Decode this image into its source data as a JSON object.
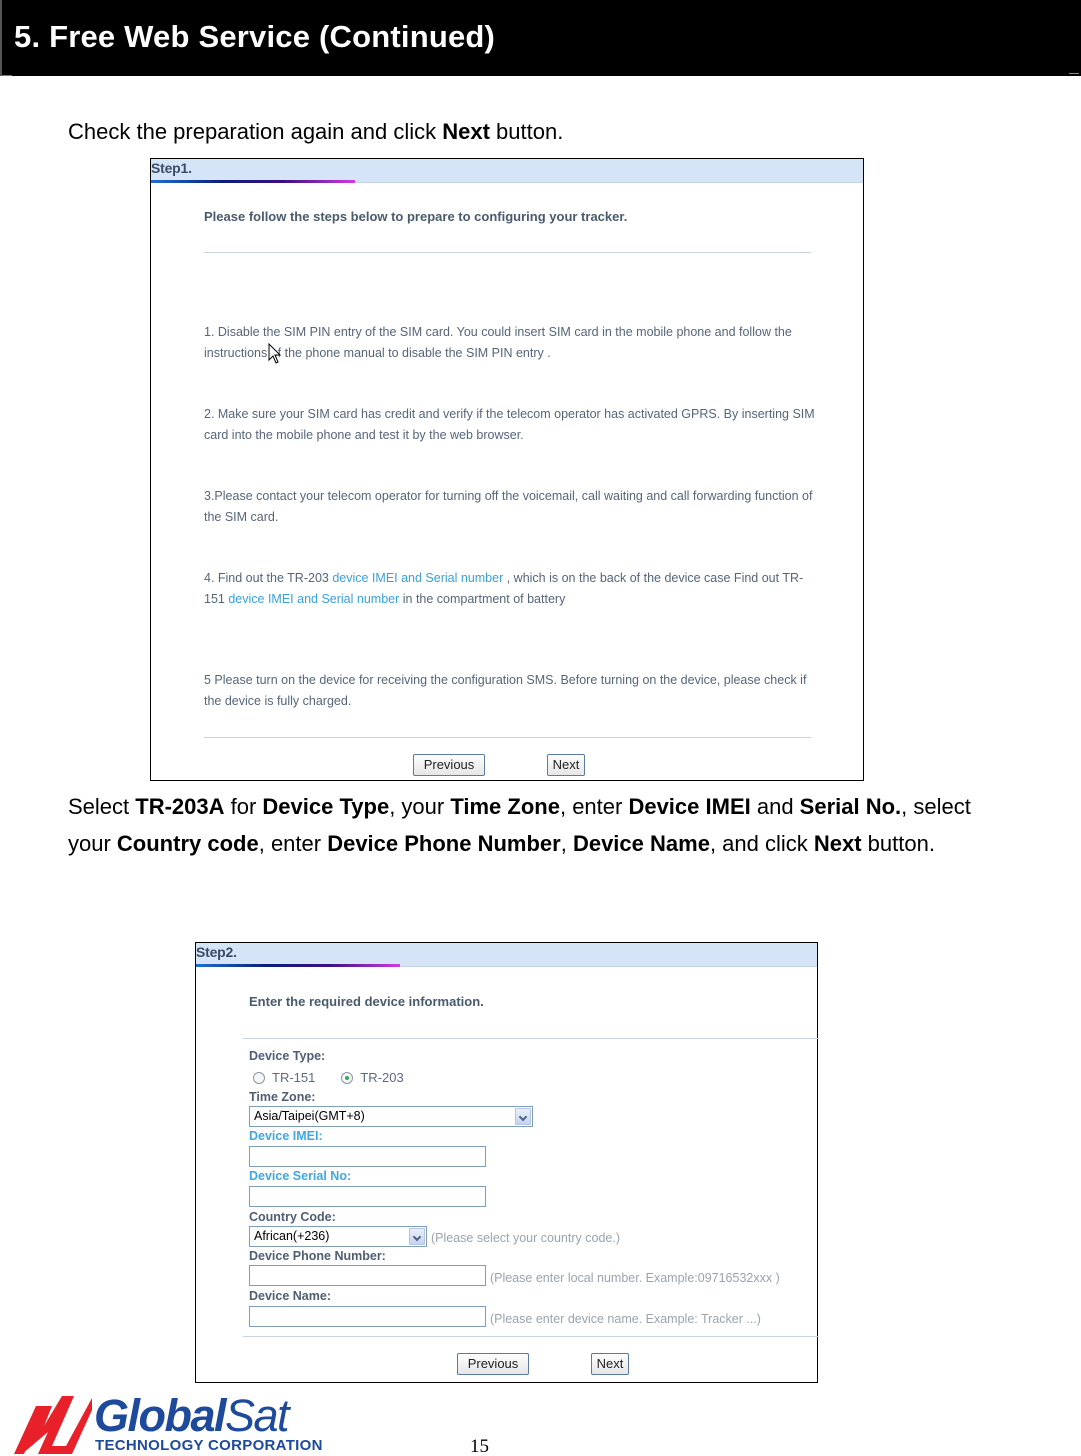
{
  "header": {
    "title": "5. Free Web Service (Continued)"
  },
  "intro_paragraph": {
    "pre": "Check the preparation again and click ",
    "bold": "Next",
    "post": " button."
  },
  "step1": {
    "label": "Step1.",
    "intro": "Please follow the steps below to prepare to configuring your tracker.",
    "items": [
      {
        "text": "1. Disable the SIM PIN entry of the SIM card. You could insert SIM card in the mobile phone and follow the instructions of the phone manual to disable the SIM PIN entry ."
      },
      {
        "text": "2. Make sure your SIM card has credit and verify if the telecom operator has activated GPRS. By inserting SIM card into the mobile phone and test it by the web browser."
      },
      {
        "text": "3.Please contact your telecom operator for turning off the voicemail, call waiting and call forwarding function of the SIM card."
      },
      {
        "part1": "4. Find out the TR-203 ",
        "link1": "device IMEI and Serial number",
        "part2": " , which is on the back of the device case Find out TR-151 ",
        "link2": "device IMEI and Serial number",
        "part3": " in the compartment of battery"
      },
      {
        "text": "5 Please turn on the device for receiving the configuration SMS. Before turning on the device, please check if the device is fully charged."
      }
    ],
    "buttons": {
      "previous": "Previous",
      "next": "Next"
    }
  },
  "instruction_paragraph": {
    "segments": [
      {
        "t": "Select ",
        "b": false
      },
      {
        "t": "TR-203A",
        "b": true
      },
      {
        "t": " for ",
        "b": false
      },
      {
        "t": "Device Type",
        "b": true
      },
      {
        "t": ", your ",
        "b": false
      },
      {
        "t": "Time Zone",
        "b": true
      },
      {
        "t": ", enter ",
        "b": false
      },
      {
        "t": "Device IMEI",
        "b": true
      },
      {
        "t": " and ",
        "b": false
      },
      {
        "t": "Serial No.",
        "b": true
      },
      {
        "t": ", select your ",
        "b": false
      },
      {
        "t": "Country code",
        "b": true
      },
      {
        "t": ", enter ",
        "b": false
      },
      {
        "t": "Device Phone Number",
        "b": true
      },
      {
        "t": ", ",
        "b": false
      },
      {
        "t": "Device Name",
        "b": true
      },
      {
        "t": ", and click ",
        "b": false
      },
      {
        "t": "Next",
        "b": true
      },
      {
        "t": " button.",
        "b": false
      }
    ]
  },
  "step2": {
    "label": "Step2.",
    "intro": "Enter the required device information.",
    "device_type": {
      "label": "Device Type:",
      "options": [
        "TR-151",
        "TR-203"
      ],
      "selected": "TR-203"
    },
    "time_zone": {
      "label": "Time Zone:",
      "value": "Asia/Taipei(GMT+8)"
    },
    "device_imei": {
      "label": "Device IMEI:",
      "value": ""
    },
    "device_serial": {
      "label": "Device Serial No:",
      "value": ""
    },
    "country_code": {
      "label": "Country Code:",
      "value": "African(+236)",
      "hint": "(Please select your country code.)"
    },
    "phone_number": {
      "label": "Device Phone Number:",
      "value": "",
      "hint": "(Please enter local number. Example:09716532xxx )"
    },
    "device_name": {
      "label": "Device Name:",
      "value": "",
      "hint": "(Please enter device name. Example: Tracker ...)"
    },
    "buttons": {
      "previous": "Previous",
      "next": "Next"
    }
  },
  "footer": {
    "brand_bold": "Global",
    "brand_light": "Sat",
    "corporation": "TECHNOLOGY CORPORATION",
    "page_number": "15"
  },
  "colors": {
    "header_bg": "#000000",
    "step_header_bg": "#d6e4f7",
    "link_blue": "#3aa0dc",
    "brand_blue": "#1e4a9c",
    "brand_red": "#e8202a"
  }
}
